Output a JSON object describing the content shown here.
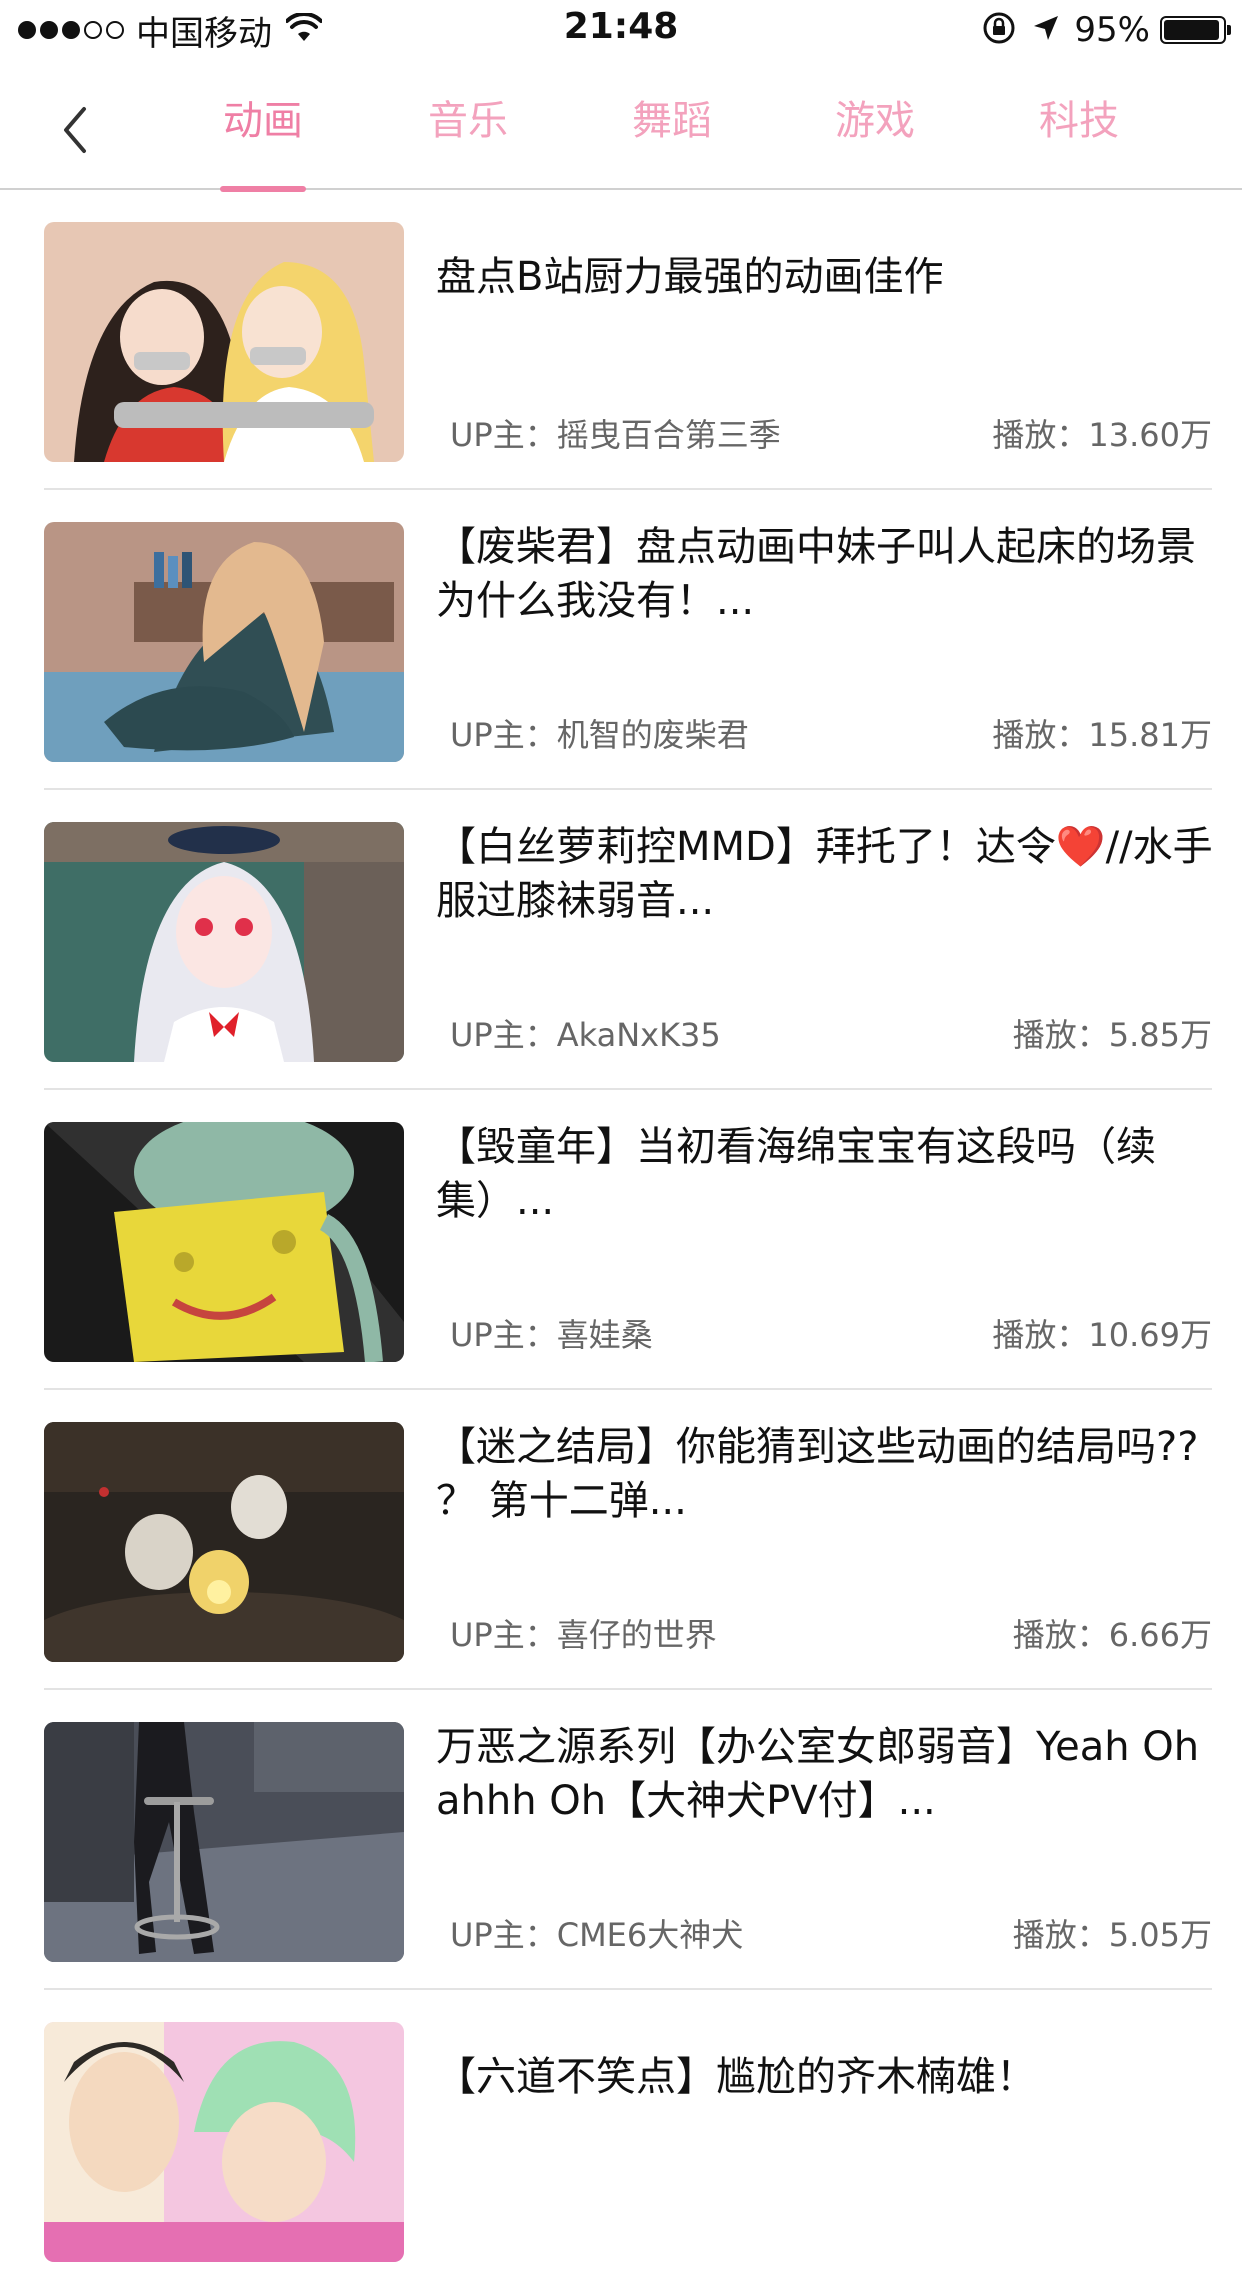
{
  "status_bar": {
    "carrier": "中国移动",
    "time": "21:48",
    "battery_percent": "95%",
    "battery_level": 0.95,
    "icons": [
      "signal-dots-icon",
      "wifi-icon",
      "orientation-lock-icon",
      "location-arrow-icon",
      "battery-icon"
    ]
  },
  "nav": {
    "back_icon": "chevron-left-icon",
    "active_tab": 0,
    "tabs": [
      {
        "label": "动画"
      },
      {
        "label": "音乐"
      },
      {
        "label": "舞蹈"
      },
      {
        "label": "游戏"
      },
      {
        "label": "科技"
      }
    ],
    "accent_color": "#ef7fa5",
    "inactive_color": "#f3a2bd"
  },
  "videos": [
    {
      "title": "盘点B站厨力最强的动画佳作",
      "uploader": "UP主：摇曳百合第三季",
      "views": "播放：13.60万"
    },
    {
      "title": "【废柴君】盘点动画中妹子叫人起床的场景  为什么我没有！...",
      "uploader": "UP主：机智的废柴君",
      "views": "播放：15.81万"
    },
    {
      "title": "【白丝萝莉控MMD】拜托了！达令❤️//水手服过膝袜弱音...",
      "uploader": "UP主：AkaNxK35",
      "views": "播放：5.85万"
    },
    {
      "title": "【毁童年】当初看海绵宝宝有这段吗（续集）...",
      "uploader": "UP主：喜娃桑",
      "views": "播放：10.69万"
    },
    {
      "title": "【迷之结局】你能猜到这些动画的结局吗?? ？ 第十二弹...",
      "uploader": "UP主：喜仔的世界",
      "views": "播放：6.66万"
    },
    {
      "title": "万恶之源系列【办公室女郎弱音】Yeah Oh ahhh Oh【大神犬PV付】...",
      "uploader": "UP主：CME6大神犬",
      "views": "播放：5.05万"
    },
    {
      "title": "【六道不笑点】尴尬的齐木楠雄！",
      "uploader": "",
      "views": ""
    }
  ]
}
